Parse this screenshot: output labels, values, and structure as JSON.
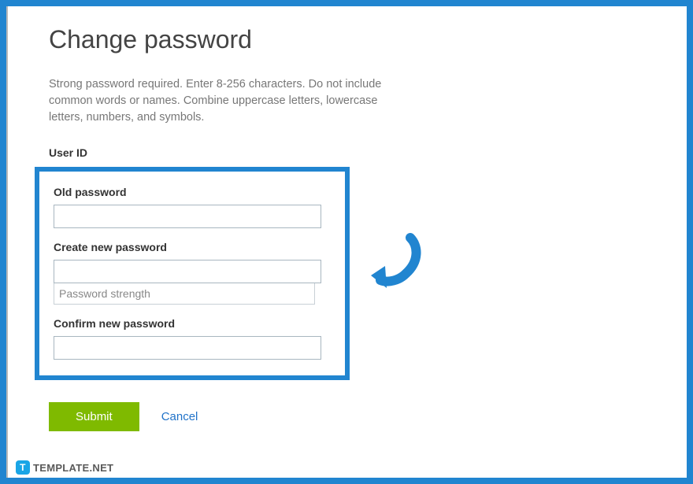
{
  "page": {
    "title": "Change password",
    "instructions": "Strong password required. Enter 8-256 characters. Do not include common words or names. Combine uppercase letters, lowercase letters, numbers, and symbols.",
    "userIdLabel": "User ID"
  },
  "form": {
    "oldPassword": {
      "label": "Old password",
      "value": ""
    },
    "newPassword": {
      "label": "Create new password",
      "value": "",
      "strengthLabel": "Password strength"
    },
    "confirmPassword": {
      "label": "Confirm new password",
      "value": ""
    }
  },
  "actions": {
    "submit": "Submit",
    "cancel": "Cancel"
  },
  "watermark": {
    "iconLetter": "T",
    "text": "TEMPLATE.NET"
  },
  "colors": {
    "frameBlue": "#2185d0",
    "submitGreen": "#7fba00",
    "linkBlue": "#2173c9"
  }
}
